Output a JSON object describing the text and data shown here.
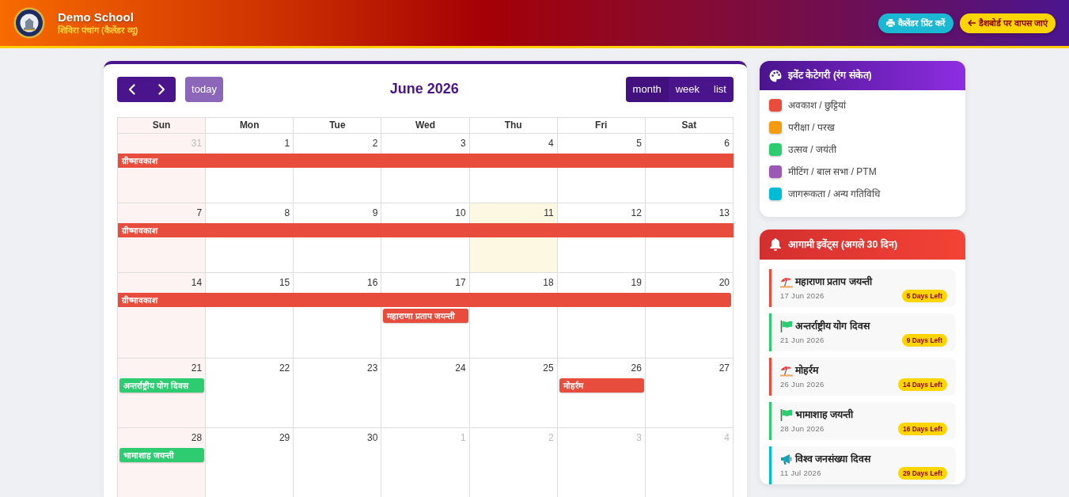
{
  "header": {
    "title": "Demo School",
    "subtitle": "शिविरा पंचांग (कैलेंडर व्यू)",
    "buttons": [
      {
        "kind": "print",
        "label": "कैलेंडर प्रिंट करें"
      },
      {
        "kind": "back",
        "label": "डैशबोर्ड पर वापस जाएं"
      }
    ]
  },
  "calendar": {
    "toolbar": {
      "today": {
        "label": "today",
        "disabled": true
      },
      "title": "June 2026",
      "views": [
        {
          "label": "month",
          "selected": true
        },
        {
          "label": "week",
          "selected": false
        },
        {
          "label": "list",
          "selected": false
        }
      ]
    },
    "weekdays": [
      {
        "label": "Sun",
        "highlighted": true
      },
      {
        "label": "Mon",
        "highlighted": false
      },
      {
        "label": "Tue",
        "highlighted": false
      },
      {
        "label": "Wed",
        "highlighted": false
      },
      {
        "label": "Thu",
        "highlighted": false
      },
      {
        "label": "Fri",
        "highlighted": false
      },
      {
        "label": "Sat",
        "highlighted": false
      }
    ],
    "weeks": [
      {
        "banner": {
          "title": "ग्रीष्मावकाश",
          "color": "#e74c3c",
          "continues_before": true,
          "continues_after": true
        },
        "days": [
          {
            "number": "31",
            "other_month": true,
            "today": false
          },
          {
            "number": "1",
            "other_month": false,
            "today": false
          },
          {
            "number": "2",
            "other_month": false,
            "today": false
          },
          {
            "number": "3",
            "other_month": false,
            "today": false
          },
          {
            "number": "4",
            "other_month": false,
            "today": false
          },
          {
            "number": "5",
            "other_month": false,
            "today": false
          },
          {
            "number": "6",
            "other_month": false,
            "today": false
          }
        ]
      },
      {
        "banner": {
          "title": "ग्रीष्मावकाश",
          "color": "#e74c3c",
          "continues_before": true,
          "continues_after": true
        },
        "days": [
          {
            "number": "7",
            "other_month": false,
            "today": false
          },
          {
            "number": "8",
            "other_month": false,
            "today": false
          },
          {
            "number": "9",
            "other_month": false,
            "today": false
          },
          {
            "number": "10",
            "other_month": false,
            "today": false
          },
          {
            "number": "11",
            "other_month": false,
            "today": true
          },
          {
            "number": "12",
            "other_month": false,
            "today": false
          },
          {
            "number": "13",
            "other_month": false,
            "today": false
          }
        ]
      },
      {
        "banner": {
          "title": "ग्रीष्मावकाश",
          "color": "#e74c3c",
          "continues_before": true,
          "continues_after": false
        },
        "days": [
          {
            "number": "14",
            "other_month": false,
            "today": false
          },
          {
            "number": "15",
            "other_month": false,
            "today": false
          },
          {
            "number": "16",
            "other_month": false,
            "today": false
          },
          {
            "number": "17",
            "other_month": false,
            "today": false,
            "events": [
              {
                "title": "महाराणा प्रताप जयन्ती",
                "color": "#e74c3c"
              }
            ]
          },
          {
            "number": "18",
            "other_month": false,
            "today": false
          },
          {
            "number": "19",
            "other_month": false,
            "today": false
          },
          {
            "number": "20",
            "other_month": false,
            "today": false
          }
        ]
      },
      {
        "days": [
          {
            "number": "21",
            "other_month": false,
            "today": false,
            "events": [
              {
                "title": "अन्तर्राष्ट्रीय योग दिवस",
                "color": "#2ecc71"
              }
            ]
          },
          {
            "number": "22",
            "other_month": false,
            "today": false
          },
          {
            "number": "23",
            "other_month": false,
            "today": false
          },
          {
            "number": "24",
            "other_month": false,
            "today": false
          },
          {
            "number": "25",
            "other_month": false,
            "today": false
          },
          {
            "number": "26",
            "other_month": false,
            "today": false,
            "events": [
              {
                "title": "मोहर्रम",
                "color": "#e74c3c"
              }
            ]
          },
          {
            "number": "27",
            "other_month": false,
            "today": false
          }
        ]
      },
      {
        "days": [
          {
            "number": "28",
            "other_month": false,
            "today": false,
            "events": [
              {
                "title": "भामाशाह जयन्ती",
                "color": "#2ecc71"
              }
            ]
          },
          {
            "number": "29",
            "other_month": false,
            "today": false
          },
          {
            "number": "30",
            "other_month": false,
            "today": false
          },
          {
            "number": "1",
            "other_month": true,
            "today": false
          },
          {
            "number": "2",
            "other_month": true,
            "today": false
          },
          {
            "number": "3",
            "other_month": true,
            "today": false
          },
          {
            "number": "4",
            "other_month": true,
            "today": false
          }
        ]
      }
    ]
  },
  "categories": {
    "title": "इवेंट केटेगरी (रंग संकेत)",
    "items": [
      {
        "label": "अवकाश / छुट्टियां",
        "color": "#e74c3c"
      },
      {
        "label": "परीक्षा / परख",
        "color": "#f39c12"
      },
      {
        "label": "उत्सव / जयंती",
        "color": "#2ecc71"
      },
      {
        "label": "मीटिंग / बाल सभा / PTM",
        "color": "#9b59b6"
      },
      {
        "label": "जागरूकता / अन्य गतिविधि",
        "color": "#00bcd4"
      }
    ]
  },
  "upcoming": {
    "title": "आगामी इवेंट्स (अगले 30 दिन)",
    "items": [
      {
        "kind": "holiday",
        "title": "महाराणा प्रताप जयन्ती",
        "date": "17 Jun 2026",
        "badge": "5 Days Left",
        "color": "#e74c3c"
      },
      {
        "kind": "festival",
        "title": "अन्तर्राष्ट्रीय योग दिवस",
        "date": "21 Jun 2026",
        "badge": "9 Days Left",
        "color": "#2ecc71"
      },
      {
        "kind": "holiday",
        "title": "मोहर्रम",
        "date": "26 Jun 2026",
        "badge": "14 Days Left",
        "color": "#e74c3c"
      },
      {
        "kind": "festival",
        "title": "भामाशाह जयन्ती",
        "date": "28 Jun 2026",
        "badge": "16 Days Left",
        "color": "#2ecc71"
      },
      {
        "kind": "awareness",
        "title": "विश्व जनसंख्या दिवस",
        "date": "11 Jul 2026",
        "badge": "29 Days Left",
        "color": "#00bcd4"
      }
    ]
  }
}
